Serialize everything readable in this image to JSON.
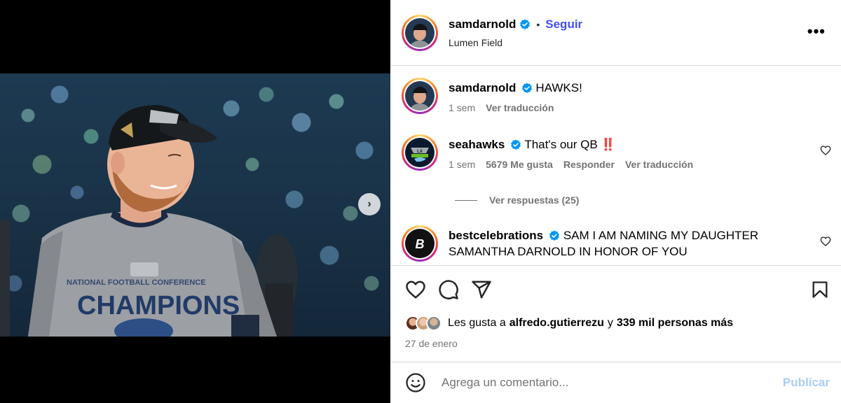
{
  "header": {
    "username": "samdarnold",
    "separator": "•",
    "follow_label": "Seguir",
    "location": "Lumen Field",
    "more_label": "•••"
  },
  "media": {
    "next_arrow": "›"
  },
  "comments": [
    {
      "username": "samdarnold",
      "text": "HAWKS!",
      "time": "1 sem",
      "translate": "Ver traducción"
    },
    {
      "username": "seahawks",
      "text": "That's our QB ‼️",
      "time": "1 sem",
      "likes": "5679 Me gusta",
      "reply": "Responder",
      "translate": "Ver traducción"
    },
    {
      "username": "bestcelebrations",
      "text_line1": "SAM I AM NAMING MY DAUGHTER",
      "text_line2": "SAMANTHA DARNOLD IN HONOR OF YOU"
    }
  ],
  "replies": {
    "label": "Ver respuestas (25)"
  },
  "likes": {
    "prefix": "Les gusta a",
    "user": "alfredo.gutierrezu",
    "connector": "y",
    "others": "339 mil personas más"
  },
  "date": "27 de enero",
  "add_comment": {
    "placeholder": "Agrega un comentario...",
    "publish_label": "Publicar"
  },
  "colors": {
    "verified": "#0095f6",
    "follow": "#4150f7",
    "publish_disabled": "#a8cdf7",
    "muted": "#737373",
    "border": "#dbdbdb"
  }
}
